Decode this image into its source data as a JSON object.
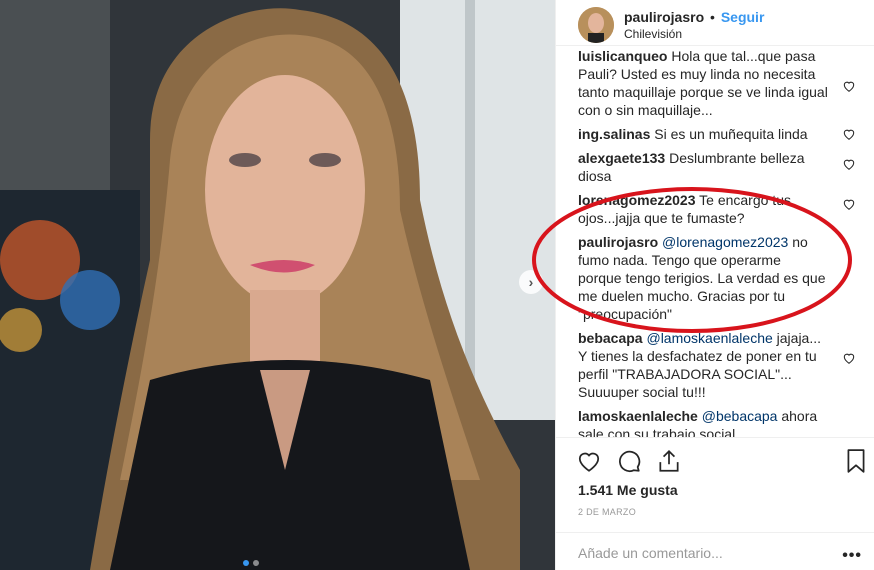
{
  "post": {
    "username": "paulirojasro",
    "separator": "•",
    "follow_label": "Seguir",
    "location": "Chilevisión",
    "likes": "1.541 Me gusta",
    "date": "2 DE MARZO",
    "add_comment_placeholder": "Añade un comentario...",
    "more_label": "•••"
  },
  "comments": [
    {
      "author": "luislicanqueo",
      "text": "Hola que tal...que pasa Pauli? Usted es muy linda no necesita tanto maquillaje porque se ve linda igual con o sin maquillaje..."
    },
    {
      "author": "ing.salinas",
      "text": "Si es un muñequita linda"
    },
    {
      "author": "alexgaete133",
      "text": "Deslumbrante belleza diosa"
    },
    {
      "author": "lorenagomez2023",
      "text": "Te encargo tus ojos...jajja que te fumaste?"
    },
    {
      "author": "paulirojasro",
      "mention": "@lorenagomez2023",
      "text": "no fumo nada. Tengo que operarme porque tengo terigios. La verdad es que me duelen mucho. Gracias por tu \"preocupación\""
    },
    {
      "author": "bebacapa",
      "mention": "@lamoskaenlaleche",
      "text": "jajaja... Y tienes la desfachatez de poner en tu perfil \"TRABAJADORA SOCIAL\"... Suuuuper social tu!!!"
    },
    {
      "author": "lamoskaenlaleche",
      "mention": "@bebacapa",
      "text": "ahora sale con su trabajo social"
    }
  ],
  "colors": {
    "accent": "#3897f0",
    "annotation": "#d8141c"
  },
  "icons": {
    "like": "heart-icon",
    "comment": "comment-bubble-icon",
    "share": "share-icon",
    "save": "bookmark-icon",
    "next": "chevron-right-icon"
  }
}
